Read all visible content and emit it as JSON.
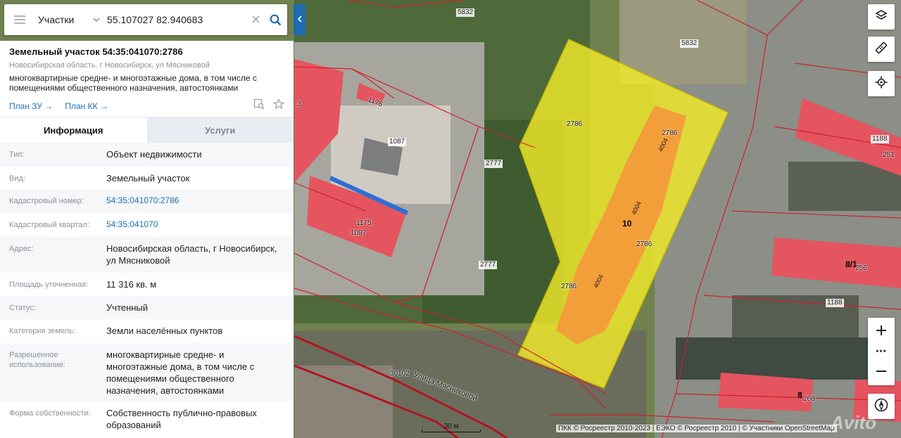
{
  "search": {
    "layer": "Участки",
    "query": "55.107027 82.940683"
  },
  "parcel": {
    "title": "Земельный участок 54:35:041070:2786",
    "address": "Новосибирская область, г Новосибирск, ул Мясниковой",
    "use": "многоквартирные средне- и многоэтажные дома, в том числе с помещениями общественного назначения, автостоянками",
    "plan_zu": "План ЗУ →",
    "plan_kk": "План КК →"
  },
  "tabs": {
    "info": "Информация",
    "services": "Услуги"
  },
  "rows": [
    {
      "label": "Тип:",
      "value": "Объект недвижимости"
    },
    {
      "label": "Вид:",
      "value": "Земельный участок"
    },
    {
      "label": "Кадастровый номер:",
      "value": "54:35:041070:2786"
    },
    {
      "label": "Кадастровый квартал:",
      "value": "54:35:041070"
    },
    {
      "label": "Адрес:",
      "value": "Новосибирская область, г Новосибирск, ул Мясниковой"
    },
    {
      "label": "Площадь уточненная:",
      "value": "11 316 кв. м"
    },
    {
      "label": "Статус:",
      "value": "Учтенный"
    },
    {
      "label": "Категория земель:",
      "value": "Земли населённых пунктов"
    },
    {
      "label": "Разрешенное использование:",
      "value": "многоквартирные средне- и многоэтажные дома, в том числе с помещениями общественного назначения, автостоянками"
    },
    {
      "label": "Форма собственности:",
      "value": "Собственность публично-правовых образований"
    }
  ],
  "map": {
    "labels": {
      "l5832a": "5832",
      "l5832b": "5832",
      "l1176": "1176",
      "l1087a": "1087",
      "l1087b": "1087",
      "l1175": "1175",
      "l2777a": "2777",
      "l2777b": "2777",
      "l2786a": "2786",
      "l2786b": "2786",
      "l2786c": "2786",
      "l2786d": "2786",
      "l10": "10",
      "l4004a": "4004",
      "l4004b": "4004",
      "l4004c": "4004",
      "l1188a": "1188",
      "l1188b": "1188",
      "l251": "251",
      "l81": "8/1",
      "l256": "256",
      "l8": "8",
      "l268": "268",
      "l30102": "30102",
      "street": "Улица Мясниковой",
      "l3": "3"
    },
    "scale": "30 м",
    "attribution": "ПКК © Росреестр 2010-2023 | ЕЭКО © Росреестр 2010 | © Участники OpenStreetMap",
    "watermark": "Avito"
  },
  "colors": {
    "accent": "#1e6bb0",
    "link": "#1f6fb5",
    "parcel_fill": "#f2ea2a",
    "building_fill": "#f39b3a",
    "boundary": "#d21f2b"
  },
  "icons": {
    "menu": "menu-icon",
    "chevron": "chevron-down-icon",
    "clear": "close-icon",
    "search": "search-icon",
    "collapse": "chevron-left-icon",
    "copy": "copy-search-icon",
    "star": "star-icon",
    "layers": "layers-icon",
    "ruler": "ruler-icon",
    "locate": "locate-icon",
    "compass": "compass-icon"
  }
}
